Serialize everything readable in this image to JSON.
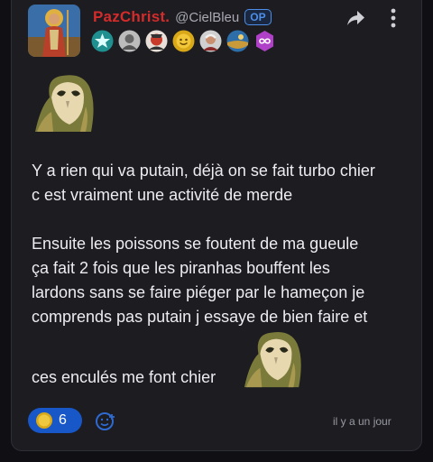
{
  "post": {
    "author": {
      "username": "PazChrist.",
      "handle": "@CielBleu",
      "op_badge": "OP",
      "avatar": "saint-icon-avatar"
    },
    "badges": [
      "star-badge",
      "portrait-badge",
      "red-face-badge",
      "gold-smiley-badge",
      "elder-portrait-badge",
      "landscape-badge",
      "infinity-badge"
    ],
    "body": {
      "paragraph1": [
        "Y a rien qui va putain, déjà on se fait turbo chier",
        "c est vraiment une activité de merde"
      ],
      "paragraph2": [
        "Ensuite les poissons se foutent de ma gueule",
        "ça fait 2 fois que les piranhas bouffent les",
        "lardons sans se faire piéger par le hameçon je",
        "comprends pas putain j essaye de bien faire et"
      ],
      "last_line": "ces enculés me font chier"
    },
    "stickers": [
      "owl-sticker",
      "owl-sticker"
    ],
    "reactions": {
      "emoji": "coin-emoji",
      "count": "6"
    },
    "timestamp": "il y a un jour"
  },
  "colors": {
    "username": "#d42b2b",
    "op_badge": "#4d8ee8",
    "reaction_pill": "#1857c8",
    "card_bg": "#1c1c21"
  }
}
